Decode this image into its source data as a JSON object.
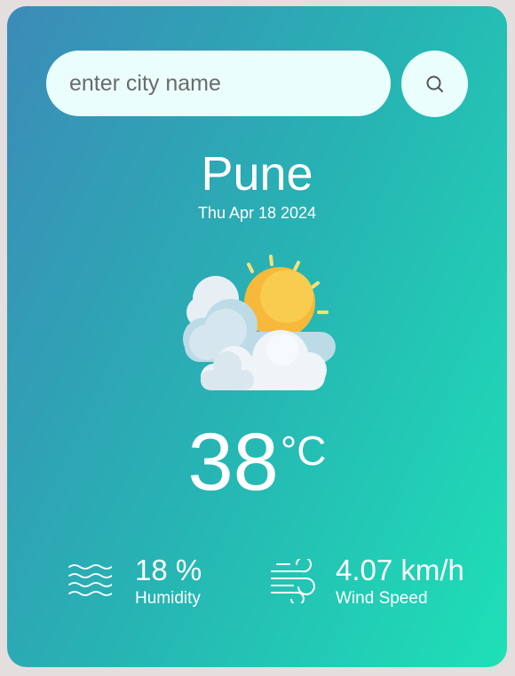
{
  "search": {
    "placeholder": "enter city name",
    "icon": "search-icon"
  },
  "location": {
    "city": "Pune",
    "date": "Thu Apr 18 2024"
  },
  "weather": {
    "icon": "partly-cloudy-sun-icon",
    "temperature": "38",
    "unit": "°C"
  },
  "details": {
    "humidity": {
      "icon": "humidity-waves-icon",
      "value": "18 %",
      "label": "Humidity"
    },
    "wind": {
      "icon": "wind-icon",
      "value": "4.07 km/h",
      "label": "Wind Speed"
    }
  },
  "colors": {
    "page_background": "#e4dede",
    "gradient_start": "#3c8bb8",
    "gradient_end": "#1ee0b6",
    "field_background": "#eafffb",
    "sun": "#f6b93b",
    "cloud": "#eef4f8"
  }
}
